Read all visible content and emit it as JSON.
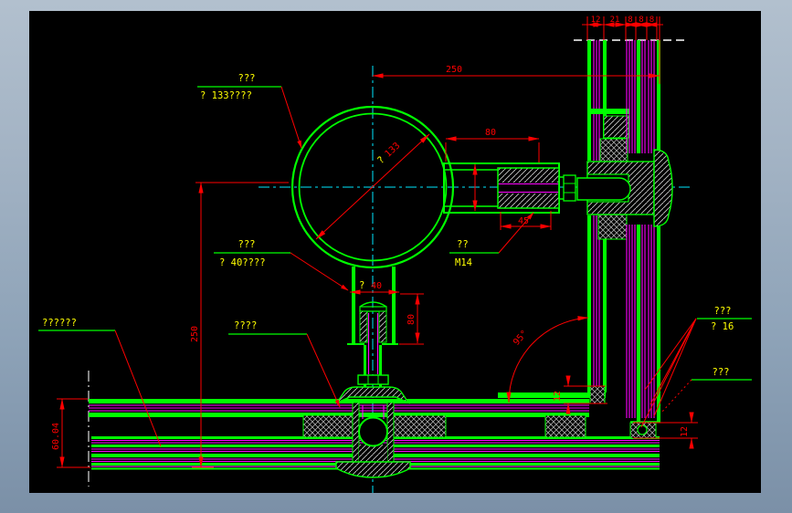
{
  "drawing": {
    "colors": {
      "background_top": "#b2c0ce",
      "background_bottom": "#7b90a7",
      "canvas": "#000000",
      "outline_green": "#00ff00",
      "layer_magenta": "#ff00ff",
      "dimension_red": "#ff0000",
      "annotation_yellow": "#ffff00",
      "centerline_cyan": "#00e8ff",
      "cutline_white": "#ffffff"
    },
    "labels": {
      "pipe": {
        "line1": "???",
        "line2": "? 133????"
      },
      "stem": {
        "line1": "???",
        "line2": "? 40????"
      },
      "bolt": {
        "line1": "??",
        "line2": "M14"
      },
      "rod": {
        "line1": "???",
        "line2": "? 16"
      },
      "glass": {
        "line1": "???"
      },
      "weld": {
        "line1": "????"
      },
      "panel": {
        "line1": "??????"
      }
    },
    "dims": {
      "top_stack": [
        "12",
        "21",
        "8",
        "8",
        "8"
      ],
      "span_250": "250",
      "arm_80": "80",
      "arm_45": "45",
      "circle_dia": {
        "prefix": "?",
        "value": "133"
      },
      "stem_dia": {
        "prefix": "?",
        "value": "40"
      },
      "stem_80": "80",
      "left_250": "250",
      "left_height": "60.04",
      "angle": "95°",
      "corner_12": "12",
      "cap_12": "12"
    }
  }
}
